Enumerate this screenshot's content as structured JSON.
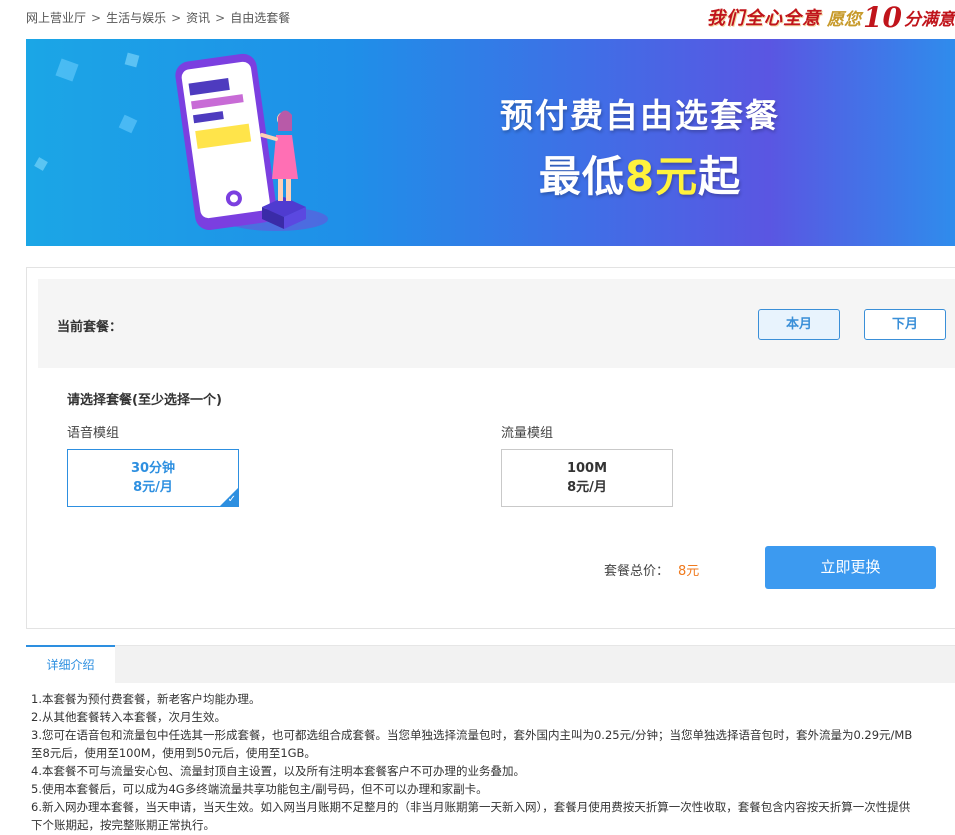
{
  "breadcrumb": {
    "items": [
      "网上营业厅",
      "生活与娱乐",
      "资讯",
      "自由选套餐"
    ],
    "separator": ">"
  },
  "slogan": {
    "part1": "我们全心全意",
    "part2": "愿您",
    "part3": "10",
    "part4": "分满意"
  },
  "banner": {
    "title": "预付费自由选套餐",
    "sub_prefix": "最低",
    "sub_highlight": "8元",
    "sub_suffix": "起",
    "highlight_color": "#fff23c"
  },
  "current": {
    "label": "当前套餐：",
    "this_month": "本月",
    "next_month": "下月"
  },
  "selection": {
    "title": "请选择套餐(至少选择一个)",
    "voice_label": "语音模组",
    "data_label": "流量模组",
    "voice_option": {
      "line1": "30分钟",
      "line2": "8元/月",
      "selected": true
    },
    "data_option": {
      "line1": "100M",
      "line2": "8元/月",
      "selected": false
    }
  },
  "total": {
    "label": "套餐总价：",
    "value": "8元"
  },
  "submit_label": "立即更换",
  "details": {
    "tab": "详细介绍",
    "lines": [
      "1.本套餐为预付费套餐，新老客户均能办理。",
      "2.从其他套餐转入本套餐，次月生效。",
      "3.您可在语音包和流量包中任选其一形成套餐，也可都选组合成套餐。当您单独选择流量包时，套外国内主叫为0.25元/分钟；当您单独选择语音包时，套外流量为0.29元/MB",
      "至8元后，使用至100M，使用到50元后，使用至1GB。",
      "4.本套餐不可与流量安心包、流量封顶自主设置，以及所有注明本套餐客户不可办理的业务叠加。",
      "5.使用本套餐后，可以成为4G多终端流量共享功能包主/副号码，但不可以办理和家副卡。",
      "6.新入网办理本套餐，当天申请，当天生效。如入网当月账期不足整月的（非当月账期第一天新入网），套餐月使用费按天折算一次性收取，套餐包含内容按天折算一次性提供",
      "下个账期起，按完整账期正常执行。"
    ]
  },
  "colors": {
    "accent": "#2d8fe0",
    "button": "#3c9af0",
    "price": "#f07a1e"
  }
}
